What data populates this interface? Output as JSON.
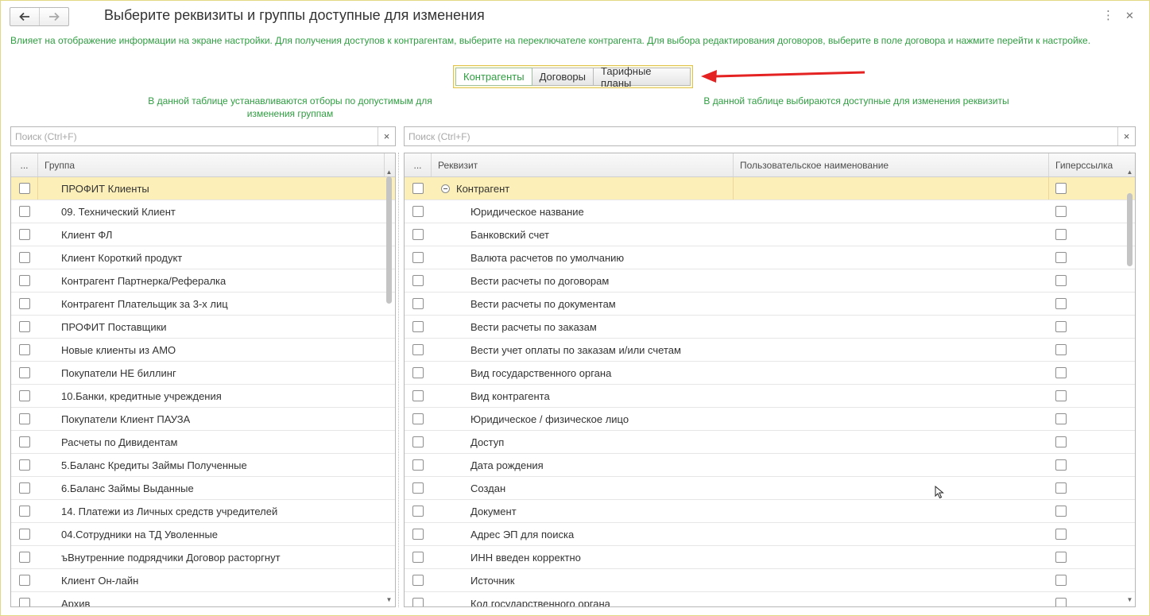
{
  "window": {
    "title": "Выберите реквизиты и группы доступные для изменения",
    "hint": "Влияет на отображение информации на экране настройки. Для получения доступов к контрагентам, выберите на переключателе контрагента. Для выбора редактирования договоров, выберите в поле договора и нажмите перейти к настройке.",
    "more_icon": "⋮",
    "close_icon": "✕"
  },
  "tabs": [
    "Контрагенты",
    "Договоры",
    "Тарифные планы"
  ],
  "active_tab_index": 0,
  "colors": {
    "accent_green": "#2f9e41",
    "selected_row": "#fcefb8",
    "arrow_red": "#e52222"
  },
  "left_panel": {
    "caption": "В данной таблице устанавливаются отборы по допустимым для изменения группам",
    "search_placeholder": "Поиск (Ctrl+F)",
    "col_dots": "...",
    "col_group": "Группа",
    "rows": [
      "ПРОФИТ Клиенты",
      "09. Технический Клиент",
      "Клиент ФЛ",
      "Клиент Короткий продукт",
      "Контрагент Партнерка/Рефералка",
      "Контрагент Плательщик за 3-х лиц",
      "ПРОФИТ Поставщики",
      "Новые клиенты из АМО",
      "Покупатели НЕ биллинг",
      "10.Банки, кредитные учреждения",
      "Покупатели Клиент ПАУЗА",
      "Расчеты по Дивидентам",
      "5.Баланс Кредиты Займы Полученные",
      "6.Баланс Займы Выданные",
      "14. Платежи из Личных средств учредителей",
      "04.Сотрудники на ТД Уволенные",
      "ъВнутренние подрядчики Договор расторгнут",
      "Клиент Он-лайн",
      "Архив"
    ]
  },
  "right_panel": {
    "caption": "В данной таблице выбираются доступные для изменения реквизиты",
    "search_placeholder": "Поиск (Ctrl+F)",
    "col_dots": "...",
    "col_attr": "Реквизит",
    "col_custom_name": "Пользовательское наименование",
    "col_hyperlink": "Гиперссылка",
    "group_row": "Контрагент",
    "rows": [
      "Юридическое название",
      "Банковский счет",
      "Валюта расчетов по умолчанию",
      "Вести расчеты по договорам",
      "Вести расчеты по документам",
      "Вести расчеты по заказам",
      "Вести учет оплаты по заказам и/или счетам",
      "Вид государственного органа",
      "Вид контрагента",
      "Юридическое / физическое лицо",
      "Доступ",
      "Дата рождения",
      "Создан",
      "Документ",
      "Адрес ЭП для поиска",
      "ИНН введен корректно",
      "Источник",
      "Код государственного органа"
    ]
  }
}
